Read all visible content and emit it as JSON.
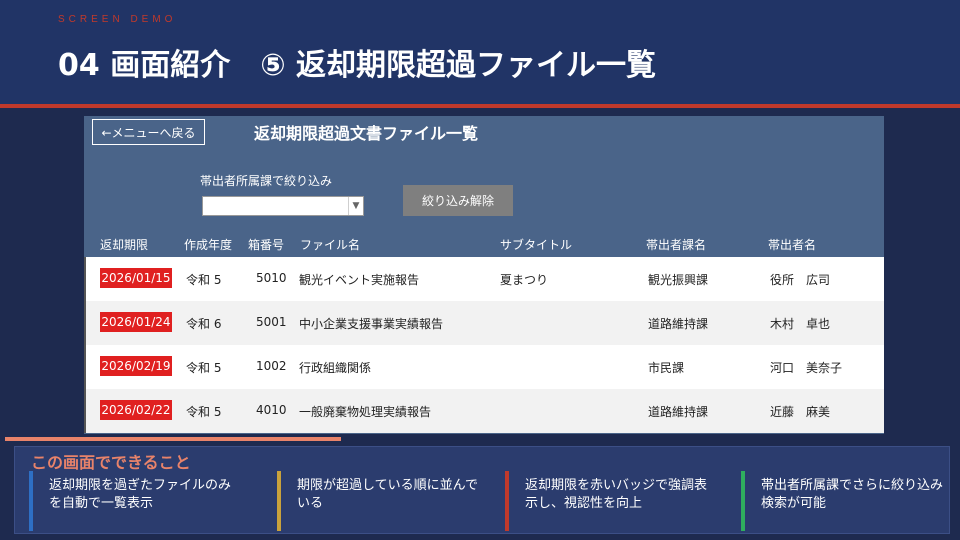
{
  "slide": {
    "kicker": "SCREEN DEMO",
    "title": "04  画面紹介　⑤ 返却期限超過ファイル一覧"
  },
  "app": {
    "back_label": "←メニューへ戻る",
    "title": "返却期限超過文書ファイル一覧",
    "filter_label": "帯出者所属課で絞り込み",
    "filter_value": "",
    "clear_label": "絞り込み解除",
    "columns": [
      "返却期限",
      "作成年度",
      "箱番号",
      "ファイル名",
      "サブタイトル",
      "帯出者課名",
      "帯出者名"
    ],
    "rows": [
      {
        "due": "2026/01/15",
        "year": "令和 5",
        "box": "5010",
        "file": "観光イベント実施報告",
        "subtitle": "夏まつり",
        "dept": "観光振興課",
        "person": "役所　広司"
      },
      {
        "due": "2026/01/24",
        "year": "令和 6",
        "box": "5001",
        "file": "中小企業支援事業実績報告",
        "subtitle": "",
        "dept": "道路維持課",
        "person": "木村　卓也"
      },
      {
        "due": "2026/02/19",
        "year": "令和 5",
        "box": "1002",
        "file": "行政組織関係",
        "subtitle": "",
        "dept": "市民課",
        "person": "河口　美奈子"
      },
      {
        "due": "2026/02/22",
        "year": "令和 5",
        "box": "4010",
        "file": "一般廃棄物処理実績報告",
        "subtitle": "",
        "dept": "道路維持課",
        "person": "近藤　麻美"
      }
    ]
  },
  "features": {
    "title": "この画面でできること",
    "items": [
      {
        "text": "返却期限を過ぎたファイルのみを自動で一覧表示",
        "color": "#2e6fc4"
      },
      {
        "text": "期限が超過している順に並んでいる",
        "color": "#c9a23c"
      },
      {
        "text": "返却期限を赤いバッジで強調表示し、視認性を向上",
        "color": "#c0392b"
      },
      {
        "text": "帯出者所属課でさらに絞り込み検索が可能",
        "color": "#2fae5e"
      }
    ]
  },
  "colors": {
    "accent_red": "#c0392b",
    "badge_red": "#e02020",
    "app_bg": "#4a6489",
    "feature_title": "#e8836a"
  }
}
